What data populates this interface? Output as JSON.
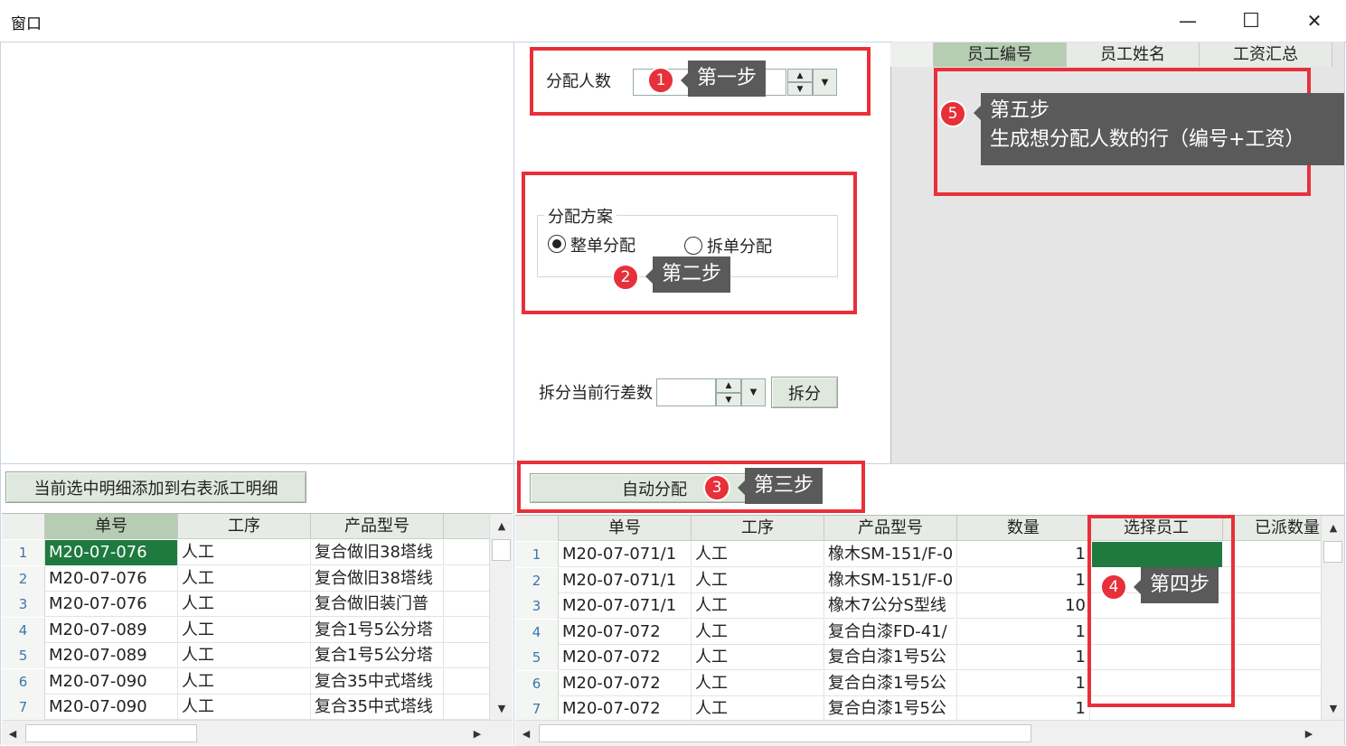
{
  "window": {
    "title": "窗口",
    "min": "—",
    "max": "☐",
    "close": "✕"
  },
  "assign": {
    "label": "分配人数",
    "value": ""
  },
  "plan": {
    "legend": "分配方案",
    "options": [
      {
        "label": "整单分配",
        "selected": true
      },
      {
        "label": "拆单分配",
        "selected": false
      }
    ]
  },
  "split": {
    "label": "拆分当前行差数",
    "value": "",
    "button": "拆分"
  },
  "auto_button": "自动分配",
  "add_button": "当前选中明细添加到右表派工明细",
  "right_top_grid": {
    "columns": [
      "员工编号",
      "员工姓名",
      "工资汇总"
    ]
  },
  "left_grid": {
    "columns": [
      "单号",
      "工序",
      "产品型号"
    ],
    "rows": [
      {
        "n": "1",
        "c": [
          "M20-07-076",
          "人工",
          "复合做旧38塔线"
        ]
      },
      {
        "n": "2",
        "c": [
          "M20-07-076",
          "人工",
          "复合做旧38塔线"
        ]
      },
      {
        "n": "3",
        "c": [
          "M20-07-076",
          "人工",
          "复合做旧装门普"
        ]
      },
      {
        "n": "4",
        "c": [
          "M20-07-089",
          "人工",
          "复合1号5公分塔"
        ]
      },
      {
        "n": "5",
        "c": [
          "M20-07-089",
          "人工",
          "复合1号5公分塔"
        ]
      },
      {
        "n": "6",
        "c": [
          "M20-07-090",
          "人工",
          "复合35中式塔线"
        ]
      },
      {
        "n": "7",
        "c": [
          "M20-07-090",
          "人工",
          "复合35中式塔线"
        ]
      }
    ]
  },
  "right_grid": {
    "columns": [
      "单号",
      "工序",
      "产品型号",
      "数量",
      "选择员工",
      "已派数量"
    ],
    "rows": [
      {
        "n": "1",
        "c": [
          "M20-07-071/1",
          "人工",
          "橡木SM-151/F-0",
          "1"
        ]
      },
      {
        "n": "2",
        "c": [
          "M20-07-071/1",
          "人工",
          "橡木SM-151/F-0",
          "1"
        ]
      },
      {
        "n": "3",
        "c": [
          "M20-07-071/1",
          "人工",
          "橡木7公分S型线",
          "10"
        ]
      },
      {
        "n": "4",
        "c": [
          "M20-07-072",
          "人工",
          "复合白漆FD-41/",
          "1"
        ]
      },
      {
        "n": "5",
        "c": [
          "M20-07-072",
          "人工",
          "复合白漆1号5公",
          "1"
        ]
      },
      {
        "n": "6",
        "c": [
          "M20-07-072",
          "人工",
          "复合白漆1号5公",
          "1"
        ]
      },
      {
        "n": "7",
        "c": [
          "M20-07-072",
          "人工",
          "复合白漆1号5公",
          "1"
        ]
      }
    ]
  },
  "annotations": {
    "step1": {
      "num": "1",
      "text": "第一步"
    },
    "step2": {
      "num": "2",
      "text": "第二步"
    },
    "step3": {
      "num": "3",
      "text": "第三步"
    },
    "step4": {
      "num": "4",
      "text": "第四步"
    },
    "step5": {
      "num": "5",
      "line1": "第五步",
      "line2": "生成想分配人数的行（编号+工资）"
    }
  },
  "colors": {
    "accent_green": "#1e7a3f",
    "header_selected": "#b6cdb4",
    "annotation_red": "#e8303a"
  }
}
